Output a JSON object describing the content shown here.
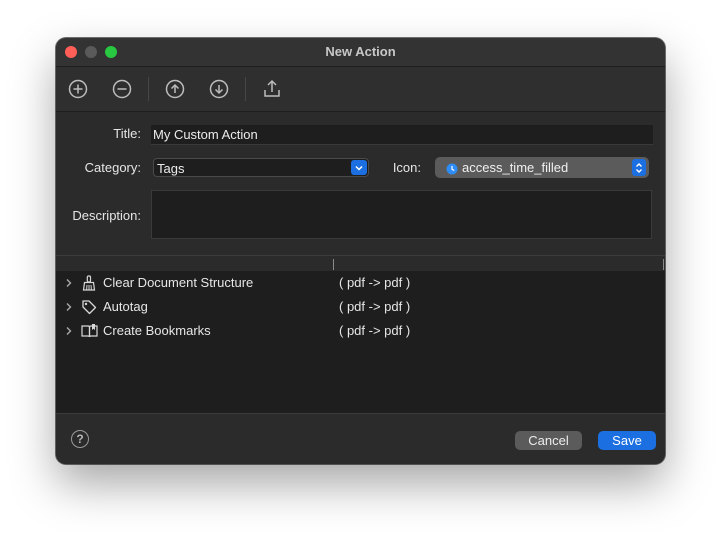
{
  "window": {
    "title": "New Action"
  },
  "toolbar": {
    "buttons": [
      {
        "name": "add",
        "icon": "plus-circle-icon"
      },
      {
        "name": "remove",
        "icon": "minus-circle-icon"
      },
      {
        "name": "move-up",
        "icon": "arrow-up-circle-icon"
      },
      {
        "name": "move-down",
        "icon": "arrow-down-circle-icon"
      },
      {
        "name": "export",
        "icon": "share-upload-icon"
      }
    ]
  },
  "form": {
    "title_label": "Title:",
    "title_value": "My Custom Action",
    "category_label": "Category:",
    "category_value": "Tags",
    "icon_label": "Icon:",
    "icon_value": "access_time_filled",
    "description_label": "Description:",
    "description_value": ""
  },
  "actions": [
    {
      "name": "Clear Document Structure",
      "io": "( pdf -> pdf )",
      "icon": "broom-icon"
    },
    {
      "name": "Autotag",
      "io": "( pdf -> pdf )",
      "icon": "tag-icon"
    },
    {
      "name": "Create Bookmarks",
      "io": "( pdf -> pdf )",
      "icon": "book-bookmark-icon"
    }
  ],
  "footer": {
    "help_label": "?",
    "cancel_label": "Cancel",
    "save_label": "Save"
  },
  "colors": {
    "accent": "#1b6fe0",
    "window_bg": "#2b2b2b",
    "list_bg": "#1e1e1e"
  }
}
